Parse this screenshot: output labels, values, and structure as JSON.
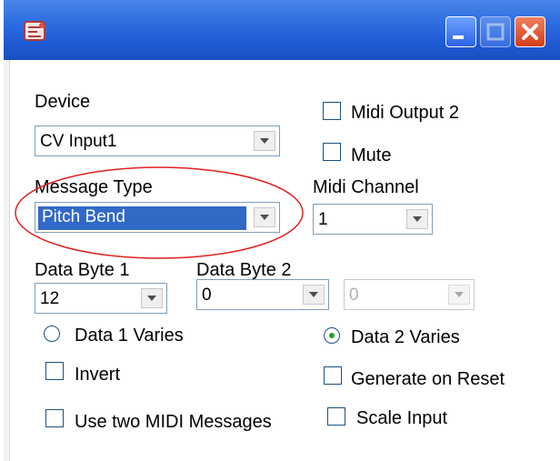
{
  "window": {
    "title": ""
  },
  "titlebar": {
    "buttons": [
      "minimize",
      "maximize",
      "close"
    ]
  },
  "device": {
    "label": "Device",
    "value": "CV Input1"
  },
  "midi_output_2": {
    "label": "Midi Output 2",
    "checked": false
  },
  "mute": {
    "label": "Mute",
    "checked": false
  },
  "message_type": {
    "label": "Message Type",
    "value": "Pitch Bend"
  },
  "midi_channel": {
    "label": "Midi Channel",
    "value": "1"
  },
  "data_byte_1": {
    "label": "Data Byte 1",
    "value": "12"
  },
  "data_byte_2": {
    "label": "Data Byte 2",
    "value": "0",
    "value_disabled": "0"
  },
  "data_1_varies": {
    "label": "Data 1 Varies",
    "selected": false
  },
  "data_2_varies": {
    "label": "Data 2 Varies",
    "selected": true
  },
  "invert": {
    "label": "Invert",
    "checked": false
  },
  "generate_on_reset": {
    "label": "Generate on Reset",
    "checked": false
  },
  "use_two_midi": {
    "label": "Use two MIDI Messages",
    "checked": false
  },
  "scale_input": {
    "label": "Scale Input",
    "checked": false
  },
  "colors": {
    "titlebar": "#2f6fe0",
    "selection": "#3169c6",
    "annotation": "#e02020"
  }
}
